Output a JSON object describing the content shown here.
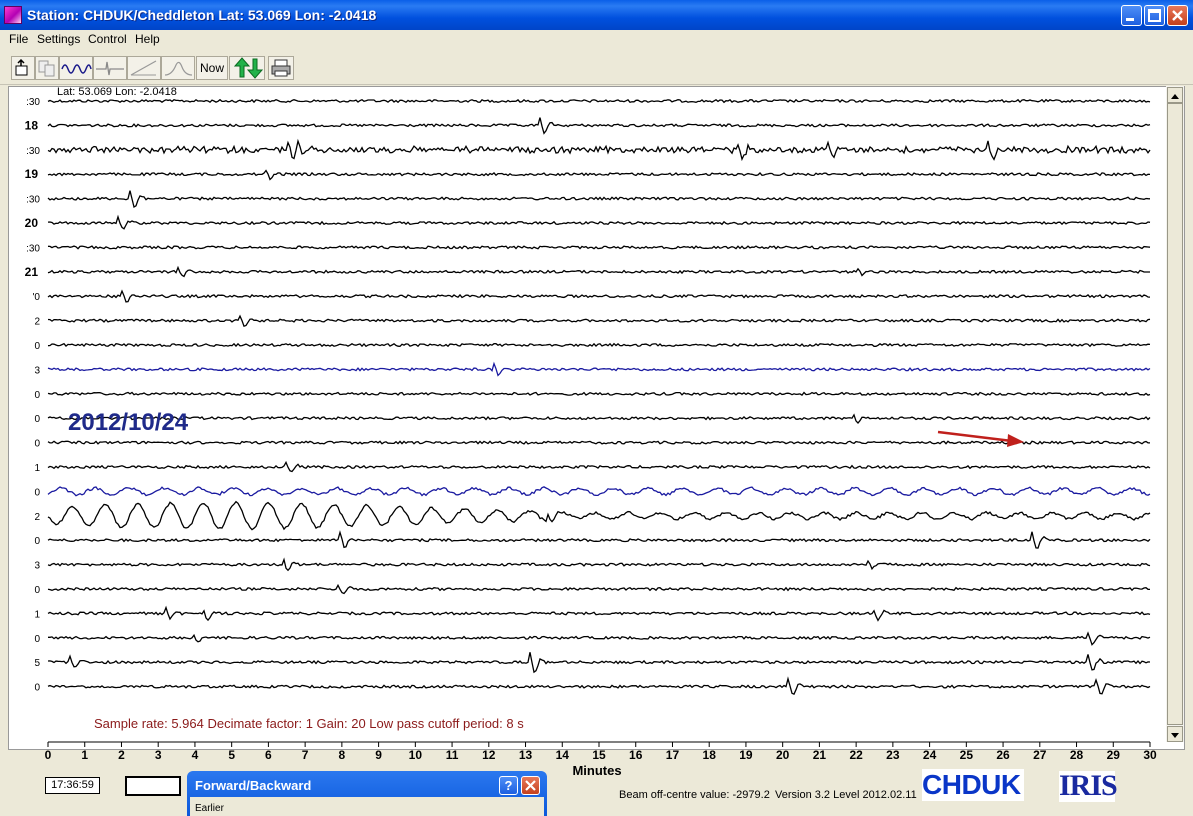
{
  "window": {
    "title": "Station: CHDUK/Cheddleton Lat: 53.069 Lon: -2.0418"
  },
  "menu": [
    "File",
    "Settings",
    "Control",
    "Help"
  ],
  "toolbar": {
    "now_label": "Now"
  },
  "plot": {
    "coord_label": "Lat: 53.069 Lon: -2.0418",
    "row_labels": [
      ":30",
      "18",
      ":30",
      "19",
      ":30",
      "20",
      ":30",
      "21",
      "'0",
      "2",
      "0",
      "3",
      "0",
      "0",
      "0",
      "1",
      "0",
      "2",
      "0",
      "3",
      "0",
      "1",
      "0",
      "5",
      "0"
    ],
    "date_label": "2012/10/24",
    "info_text": "Sample rate: 5.964  Decimate factor: 1  Gain: 20  Low pass cutoff period: 8 s",
    "x_ticks": [
      "0",
      "1",
      "2",
      "3",
      "4",
      "5",
      "6",
      "7",
      "8",
      "9",
      "10",
      "11",
      "12",
      "13",
      "14",
      "15",
      "16",
      "17",
      "18",
      "19",
      "20",
      "21",
      "22",
      "23",
      "24",
      "25",
      "26",
      "27",
      "28",
      "29",
      "30"
    ],
    "x_axis_label": "Minutes",
    "colors": {
      "trace": "#000000",
      "trace_alt": "#1a1aa0",
      "date": "#1f2a8a",
      "info": "#8b1a1a",
      "arrow": "#c0201c"
    }
  },
  "status": {
    "time": "17:36:59"
  },
  "dialog": {
    "title": "Forward/Backward",
    "body_text": "Earlier"
  },
  "footer": {
    "beam_text": "Beam off-centre value: -2979.2",
    "version_text": "Version 3.2 Level 2012.02.11",
    "logo_left": "CHDUK",
    "logo_right": "IRIS"
  }
}
